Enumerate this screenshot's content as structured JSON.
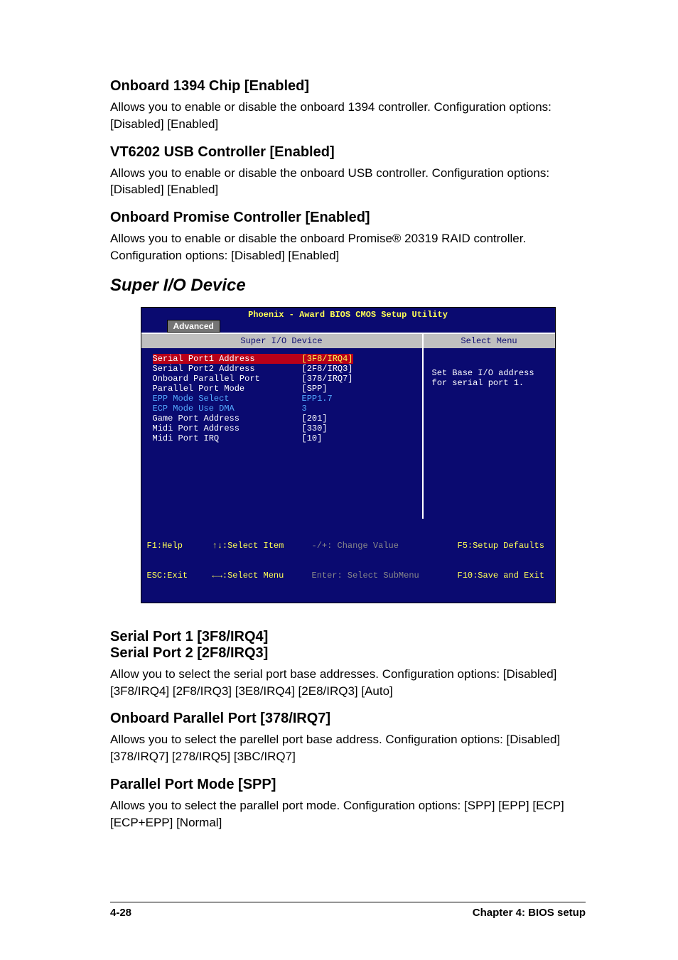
{
  "sections": [
    {
      "heading": "Onboard 1394 Chip [Enabled]",
      "body": "Allows you to enable or disable the onboard 1394 controller. Configuration options: [Disabled] [Enabled]"
    },
    {
      "heading": "VT6202 USB Controller [Enabled]",
      "body": "Allows you to enable or disable the onboard USB controller. Configuration options: [Disabled] [Enabled]"
    },
    {
      "heading": "Onboard Promise Controller [Enabled]",
      "body": "Allows you to enable or disable the onboard Promise® 20319 RAID controller. Configuration options: [Disabled] [Enabled]"
    }
  ],
  "super_io_heading": "Super I/O Device",
  "bios": {
    "title": "Phoenix - Award BIOS CMOS Setup Utility",
    "tab": "Advanced",
    "left_header": "Super I/O Device",
    "right_header": "Select Menu",
    "help_text": "Set Base I/O address for serial port 1.",
    "rows": [
      {
        "label": "Serial Port1 Address",
        "value": "[3F8/IRQ4]",
        "selected": true
      },
      {
        "label": "Serial Port2 Address",
        "value": "[2F8/IRQ3]"
      },
      {
        "label": "Onboard Parallel Port",
        "value": "[378/IRQ7]"
      },
      {
        "label": "Parallel Port Mode",
        "value": "[SPP]"
      },
      {
        "label": "EPP Mode Select",
        "value": "EPP1.7",
        "cyan": true
      },
      {
        "label": "ECP Mode Use DMA",
        "value": "3",
        "cyan": true
      },
      {
        "label": "Game Port Address",
        "value": "[201]"
      },
      {
        "label": "Midi Port Address",
        "value": "[330]"
      },
      {
        "label": "Midi Port IRQ",
        "value": "[10]"
      }
    ],
    "footer": {
      "r1c1": "F1:Help",
      "r1c2": "↑↓:Select Item",
      "r1c3": "-/+: Change Value",
      "r1c4": "F5:Setup Defaults",
      "r2c1": "ESC:Exit",
      "r2c2": "←→:Select Menu",
      "r2c3": "Enter: Select SubMenu",
      "r2c4": "F10:Save and Exit"
    }
  },
  "sections2": [
    {
      "heading": "Serial Port 1 [3F8/IRQ4]",
      "heading2": "Serial Port 2 [2F8/IRQ3]",
      "body": "Allow you to select the serial port base addresses. Configuration options: [Disabled] [3F8/IRQ4] [2F8/IRQ3] [3E8/IRQ4] [2E8/IRQ3] [Auto]"
    },
    {
      "heading": "Onboard Parallel Port [378/IRQ7]",
      "body": "Allows you to select the parellel port base address. Configuration options: [Disabled] [378/IRQ7] [278/IRQ5] [3BC/IRQ7]"
    },
    {
      "heading": "Parallel Port Mode [SPP]",
      "body": "Allows you to select the parallel port mode. Configuration options: [SPP] [EPP] [ECP] [ECP+EPP] [Normal]"
    }
  ],
  "footer": {
    "left": "4-28",
    "right": "Chapter 4: BIOS setup"
  }
}
